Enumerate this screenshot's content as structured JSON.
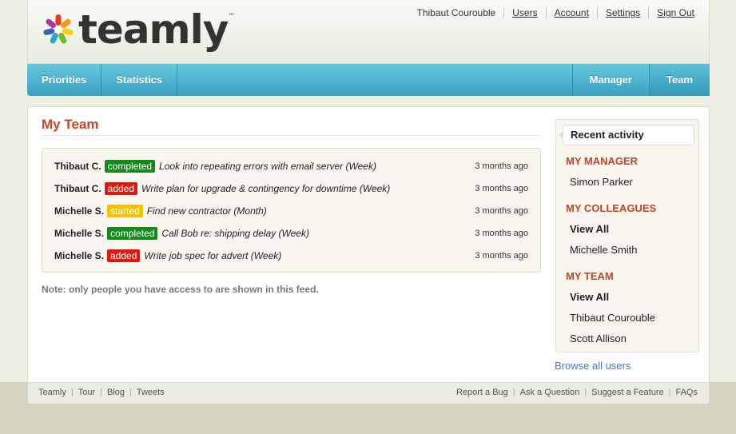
{
  "brand": {
    "name": "teamly",
    "tm": "™"
  },
  "user_nav": {
    "user_name": "Thibaut Courouble",
    "links": [
      "Users",
      "Account",
      "Settings",
      "Sign Out"
    ]
  },
  "main_nav": {
    "left": [
      "Priorities",
      "Statistics"
    ],
    "right": [
      "Manager",
      "Team"
    ]
  },
  "page": {
    "title": "My Team",
    "feed": [
      {
        "user": "Thibaut C.",
        "status": "completed",
        "task": "Look into repeating errors with email server (Week)",
        "time": "3 months ago"
      },
      {
        "user": "Thibaut C.",
        "status": "added",
        "task": "Write plan for upgrade & contingency for downtime (Week)",
        "time": "3 months ago"
      },
      {
        "user": "Michelle S.",
        "status": "started",
        "task": "Find new contractor (Month)",
        "time": "3 months ago"
      },
      {
        "user": "Michelle S.",
        "status": "completed",
        "task": "Call Bob re: shipping delay (Week)",
        "time": "3 months ago"
      },
      {
        "user": "Michelle S.",
        "status": "added",
        "task": "Write job spec for advert (Week)",
        "time": "3 months ago"
      }
    ],
    "note": "Note: only people you have access to are shown in this feed."
  },
  "sidebar": {
    "tab": "Recent activity",
    "manager_heading": "MY MANAGER",
    "manager": "Simon Parker",
    "colleagues_heading": "MY COLLEAGUES",
    "colleagues_view_all": "View All",
    "colleagues": [
      "Michelle Smith"
    ],
    "team_heading": "MY TEAM",
    "team_view_all": "View All",
    "team": [
      "Thibaut Courouble",
      "Scott Allison"
    ],
    "browse_link": "Browse all users"
  },
  "footer": {
    "left": [
      "Teamly",
      "Tour",
      "Blog",
      "Tweets"
    ],
    "right": [
      "Report a Bug",
      "Ask a Question",
      "Suggest a Feature",
      "FAQs"
    ]
  },
  "colors": {
    "accent_red": "#c0452a",
    "nav_blue": "#3aa1c2",
    "completed": "#148a1c",
    "added": "#d81b15",
    "started": "#f2c10b",
    "link_blue": "#3d7cc4"
  }
}
